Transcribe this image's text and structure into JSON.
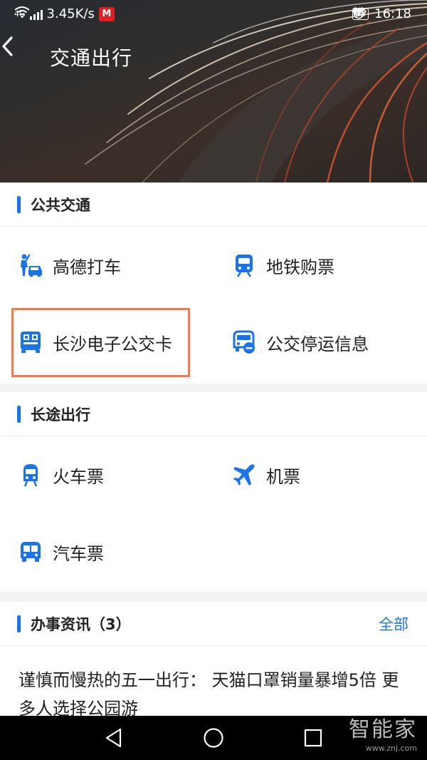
{
  "status": {
    "signal": "4G",
    "speed": "3.45K/s",
    "app_icon": "M",
    "battery": "85",
    "time": "16:18"
  },
  "header": {
    "title": "交通出行"
  },
  "public_transport": {
    "title": "公共交通",
    "items": [
      {
        "label": "高德打车",
        "icon": "taxi-hail-icon"
      },
      {
        "label": "地铁购票",
        "icon": "metro-icon"
      },
      {
        "label": "长沙电子公交卡",
        "icon": "bus-qr-icon"
      },
      {
        "label": "公交停运信息",
        "icon": "bus-stop-info-icon"
      }
    ]
  },
  "long_distance": {
    "title": "长途出行",
    "items": [
      {
        "label": "火车票",
        "icon": "train-icon"
      },
      {
        "label": "机票",
        "icon": "plane-icon"
      },
      {
        "label": "汽车票",
        "icon": "coach-icon"
      }
    ]
  },
  "news": {
    "title": "办事资讯（3）",
    "more": "全部",
    "headline": "谨慎而慢热的五一出行： 天猫口罩销量暴增5倍 更多人选择公园游"
  },
  "watermark": {
    "brand": "智能家",
    "url": "www.znj.com"
  },
  "colors": {
    "accent": "#1a73e8",
    "highlight": "#ee7a4a"
  }
}
